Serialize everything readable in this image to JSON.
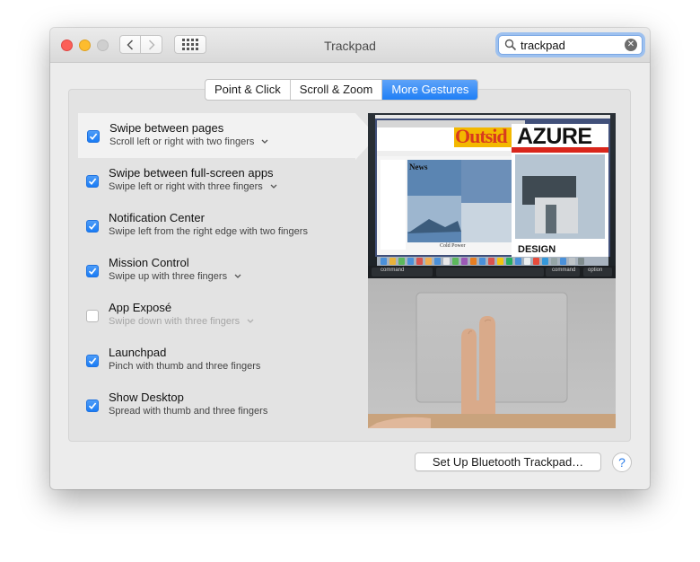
{
  "window": {
    "title": "Trackpad"
  },
  "search": {
    "value": "trackpad"
  },
  "tabs": [
    {
      "label": "Point & Click",
      "active": false
    },
    {
      "label": "Scroll & Zoom",
      "active": false
    },
    {
      "label": "More Gestures",
      "active": true
    }
  ],
  "gestures": [
    {
      "name": "Swipe between pages",
      "desc": "Scroll left or right with two fingers",
      "checked": true,
      "has_menu": true
    },
    {
      "name": "Swipe between full-screen apps",
      "desc": "Swipe left or right with three fingers",
      "checked": true,
      "has_menu": true
    },
    {
      "name": "Notification Center",
      "desc": "Swipe left from the right edge with two fingers",
      "checked": true,
      "has_menu": false
    },
    {
      "name": "Mission Control",
      "desc": "Swipe up with three fingers",
      "checked": true,
      "has_menu": true
    },
    {
      "name": "App Exposé",
      "desc": "Swipe down with three fingers",
      "checked": false,
      "has_menu": true
    },
    {
      "name": "Launchpad",
      "desc": "Pinch with thumb and three fingers",
      "checked": true,
      "has_menu": false
    },
    {
      "name": "Show Desktop",
      "desc": "Spread with thumb and three fingers",
      "checked": true,
      "has_menu": false
    }
  ],
  "preview": {
    "magazine_left": "Outsid",
    "magazine_right": "AZURE",
    "design_label": "DESIGN",
    "news_label": "News",
    "caption": "Cold Power",
    "keys": [
      "command",
      "command",
      "option"
    ]
  },
  "footer": {
    "setup_button": "Set Up Bluetooth Trackpad…",
    "help_button": "?"
  },
  "colors": {
    "accent": "#1f7ff6",
    "close": "#fc5f57",
    "minimize": "#fdbc2e"
  }
}
